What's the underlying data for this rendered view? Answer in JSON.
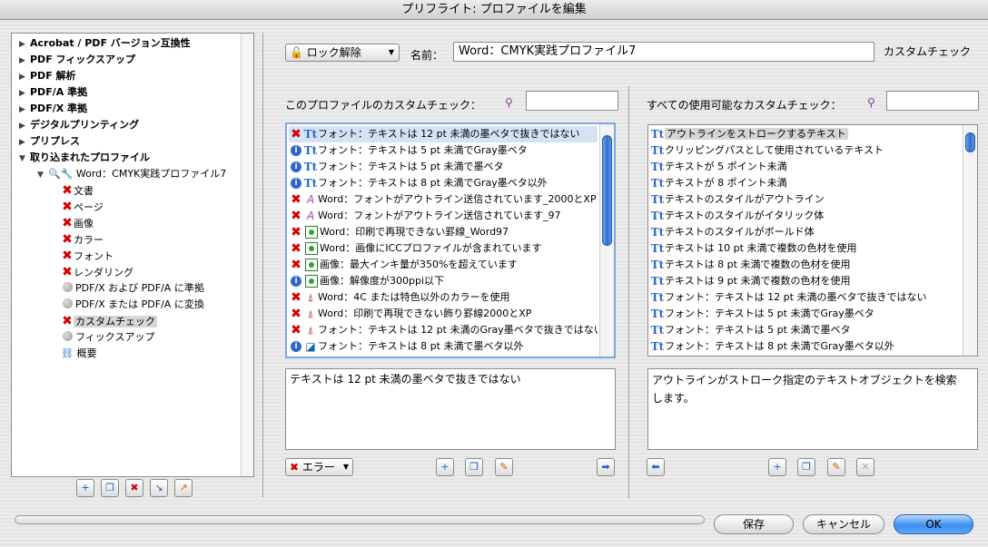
{
  "window": {
    "title": "プリフライト: プロファイルを編集"
  },
  "tree": {
    "categories": [
      "Acrobat / PDF バージョン互換性",
      "PDF フィックスアップ",
      "PDF 解析",
      "PDF/A 準拠",
      "PDF/X 準拠",
      "デジタルプリンティング",
      "プリプレス",
      "取り込まれたプロファイル"
    ],
    "profile_name": "Word：CMYK実践プロファイル7",
    "children": [
      "文書",
      "ページ",
      "画像",
      "カラー",
      "フォント",
      "レンダリング",
      "PDF/X および PDF/A に準拠",
      "PDF/X または PDF/A に変換",
      "カスタムチェック",
      "フィックスアップ",
      "概要"
    ]
  },
  "toolbar": {
    "lock_label": "ロック解除",
    "name_label": "名前：",
    "name_value": "Word：CMYK実践プロファイル7",
    "section_label": "カスタムチェック"
  },
  "profile_checks": {
    "heading": "このプロファイルのカスタムチェック：",
    "items": [
      {
        "icon": "error",
        "type": "text",
        "label": "フォント：テキストは 12 pt 未満の墨ベタで抜きではない"
      },
      {
        "icon": "info",
        "type": "text",
        "label": "フォント：テキストは 5 pt 未満でGray墨ベタ"
      },
      {
        "icon": "info",
        "type": "text",
        "label": "フォント：テキストは 5 pt 未満で墨ベタ"
      },
      {
        "icon": "info",
        "type": "text",
        "label": "フォント：テキストは 8 pt 未満でGray墨ベタ以外"
      },
      {
        "icon": "error",
        "type": "font",
        "label": "Word：フォントがアウトライン送信されています_2000とXP"
      },
      {
        "icon": "error",
        "type": "font",
        "label": "Word：フォントがアウトライン送信されています_97"
      },
      {
        "icon": "error",
        "type": "image",
        "label": "Word：印刷で再現できない罫線_Word97"
      },
      {
        "icon": "error",
        "type": "image",
        "label": "Word：画像にICCプロファイルが含まれています"
      },
      {
        "icon": "error",
        "type": "image",
        "label": "画像：最大インキ量が350%を超えています"
      },
      {
        "icon": "info",
        "type": "image",
        "label": "画像：解像度が300ppi以下"
      },
      {
        "icon": "error",
        "type": "color",
        "label": "Word：4C または特色以外のカラーを使用"
      },
      {
        "icon": "error",
        "type": "color",
        "label": "Word：印刷で再現できない飾り罫線2000とXP"
      },
      {
        "icon": "error",
        "type": "color",
        "label": "フォント：テキストは 12 pt 未満のGray墨ベタで抜きではない"
      },
      {
        "icon": "info",
        "type": "colorg",
        "label": "フォント：テキストは 8 pt 未満で墨ベタ以外"
      }
    ],
    "description": "テキストは 12 pt 未満の墨ベタで抜きではない",
    "severity_label": "エラー"
  },
  "available_checks": {
    "heading": "すべての使用可能なカスタムチェック：",
    "items": [
      "アウトラインをストロークするテキスト",
      "クリッピングパスとして使用されているテキスト",
      "テキストが 5 ポイント未満",
      "テキストが 8 ポイント未満",
      "テキストのスタイルがアウトライン",
      "テキストのスタイルがイタリック体",
      "テキストのスタイルがボールド体",
      "テキストは 10 pt 未満で複数の色材を使用",
      "テキストは 8 pt 未満で複数の色材を使用",
      "テキストは 9 pt 未満で複数の色材を使用",
      "フォント：テキストは 12 pt 未満の墨ベタで抜きではない",
      "フォント：テキストは 5 pt 未満でGray墨ベタ",
      "フォント：テキストは 5 pt 未満で墨ベタ",
      "フォント：テキストは 8 pt 未満でGray墨ベタ以外"
    ],
    "description": "アウトラインがストローク指定のテキストオブジェクトを検索します。"
  },
  "footer": {
    "save_label": "保存",
    "cancel_label": "キャンセル",
    "ok_label": "OK"
  }
}
